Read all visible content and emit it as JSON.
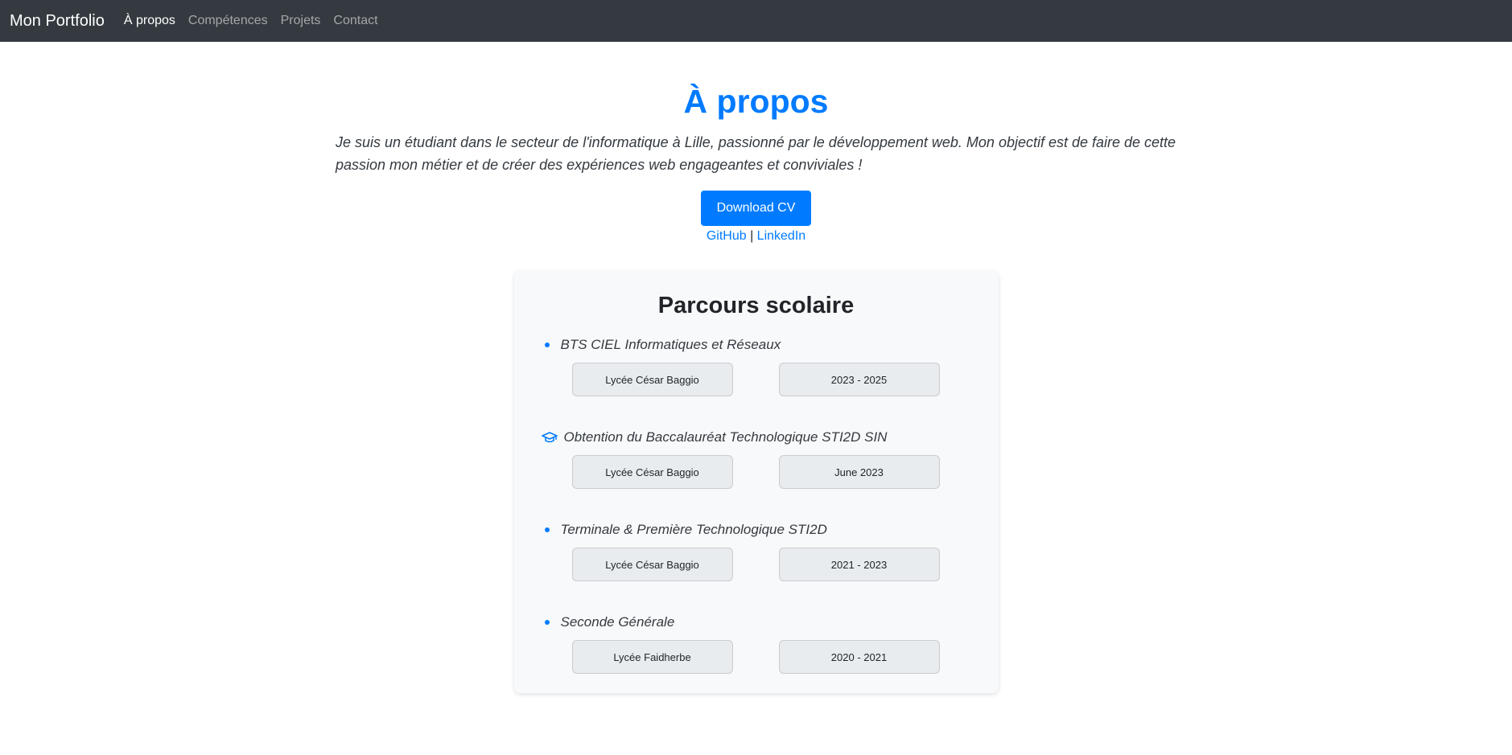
{
  "nav": {
    "brand": "Mon Portfolio",
    "links": [
      "À propos",
      "Compétences",
      "Projets",
      "Contact"
    ]
  },
  "about": {
    "title": "À propos",
    "bio": "Je suis un étudiant dans le secteur de l'informatique à Lille, passionné par le développement web. Mon objectif est de faire de cette passion mon métier et de créer des expériences web engageantes et conviviales !",
    "cv_button": "Download CV",
    "github": "GitHub",
    "separator": "|",
    "linkedin": "LinkedIn"
  },
  "education": {
    "title": "Parcours scolaire",
    "entries": [
      {
        "title": "BTS CIEL Informatiques et Réseaux",
        "school": "Lycée César Baggio",
        "date": "2023 - 2025",
        "icon": "bullet"
      },
      {
        "title": "Obtention du Baccalauréat Technologique STI2D SIN",
        "school": "Lycée César Baggio",
        "date": "June 2023",
        "icon": "graduation-cap-icon"
      },
      {
        "title": "Terminale & Première Technologique STI2D",
        "school": "Lycée César Baggio",
        "date": "2021 - 2023",
        "icon": "bullet"
      },
      {
        "title": "Seconde Générale",
        "school": "Lycée Faidherbe",
        "date": "2020 - 2021",
        "icon": "bullet"
      }
    ]
  },
  "colors": {
    "navbar": "#343a40",
    "accent": "#007bff",
    "card_bg": "#f8f9fa"
  }
}
